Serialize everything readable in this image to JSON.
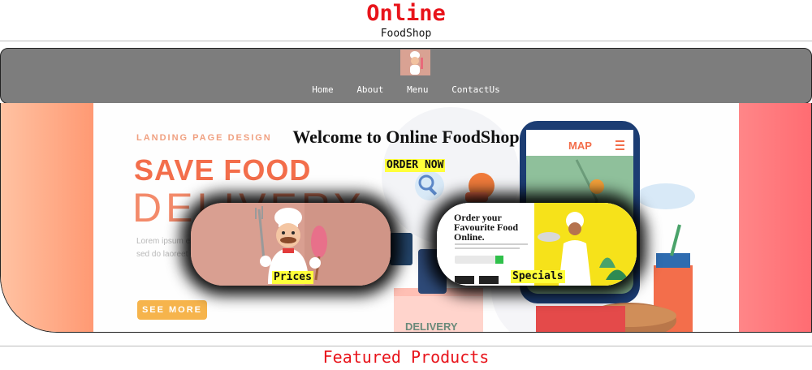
{
  "brand": {
    "title": "Online",
    "subtitle": "FoodShop"
  },
  "nav": {
    "items": [
      "Home",
      "About",
      "Menu",
      "ContactUs"
    ]
  },
  "hero": {
    "banner_kicker": "LANDING PAGE DESIGN",
    "banner_headline": "SAVE FOOD",
    "banner_headline2": "DELIVERY",
    "banner_body": "Lorem ipsum elit, sed do laoreet dolo",
    "banner_button": "SEE MORE",
    "map_label": "MAP",
    "box_label": "DELIVERY",
    "welcome": "Welcome to Online FoodShop",
    "order_button": "ORDER NOW"
  },
  "cards": [
    {
      "label": "Prices"
    },
    {
      "label": "Specials",
      "image_heading": "Order your Favourite Food Online."
    }
  ],
  "featured": {
    "title": "Featured Products"
  },
  "colors": {
    "brand_red": "#e8141b",
    "nav_gray": "#7d7d7d",
    "highlight": "#ffff3a",
    "hero_left": "#ff9973",
    "hero_right": "#ff6c72"
  }
}
